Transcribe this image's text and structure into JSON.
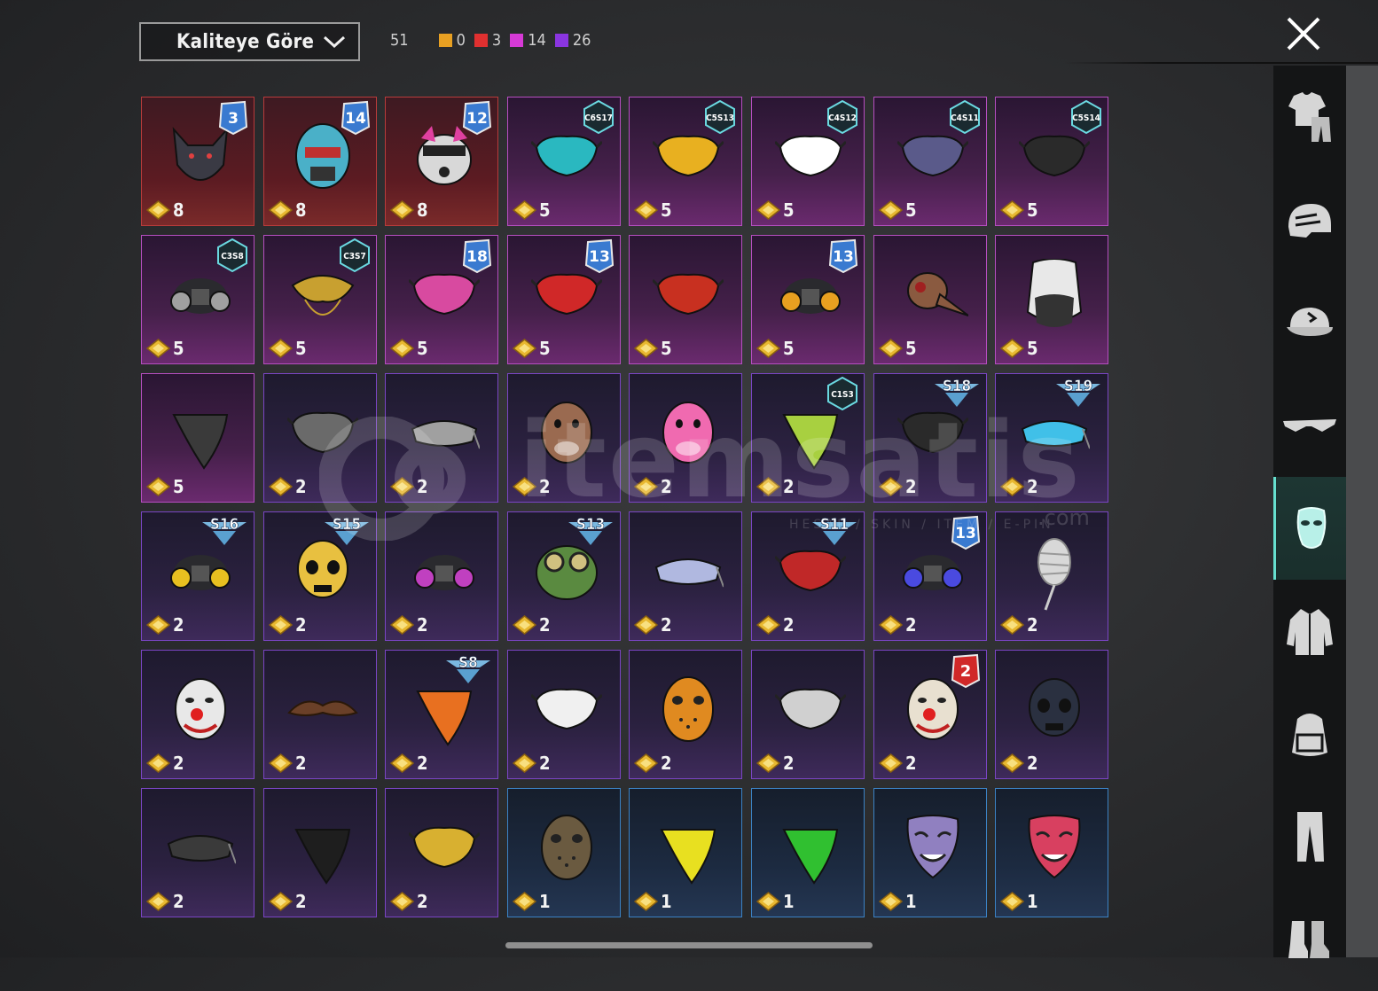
{
  "sort": {
    "label": "Kaliteye Göre"
  },
  "counts": {
    "total": "51",
    "quality": [
      {
        "color": "#e8a022",
        "value": "0"
      },
      {
        "color": "#e03030",
        "value": "3"
      },
      {
        "color": "#d63ad6",
        "value": "14"
      },
      {
        "color": "#8a35e0",
        "value": "26"
      }
    ]
  },
  "watermark": {
    "text": "itemsatis",
    "sub": "HESAP / SKIN / ITEM / E-PIN",
    "domain": ".com"
  },
  "sidebar": {
    "categories": [
      {
        "name": "outfit",
        "icon": "outfit-icon"
      },
      {
        "name": "helmet",
        "icon": "helmet-icon"
      },
      {
        "name": "hat",
        "icon": "cap-icon"
      },
      {
        "name": "glasses",
        "icon": "glasses-icon"
      },
      {
        "name": "mask",
        "icon": "mask-icon",
        "active": true
      },
      {
        "name": "jacket",
        "icon": "jacket-icon"
      },
      {
        "name": "backpack",
        "icon": "backpack-icon"
      },
      {
        "name": "pants",
        "icon": "pants-icon"
      },
      {
        "name": "shoes",
        "icon": "shoes-icon"
      }
    ]
  },
  "items": [
    {
      "rarity": "red",
      "badge": "3",
      "badge_type": "rank",
      "price": "8",
      "art": "wolf-mask",
      "color": "#3a3a44"
    },
    {
      "rarity": "red",
      "badge": "14",
      "badge_type": "rank",
      "price": "8",
      "art": "cyber-helmet-mask",
      "color": "#4ab0c8"
    },
    {
      "rarity": "red",
      "badge": "12",
      "badge_type": "rank",
      "price": "8",
      "art": "dog-mask",
      "color": "#d8d8d8"
    },
    {
      "rarity": "pink",
      "badge": "C6S17",
      "badge_type": "season",
      "price": "5",
      "art": "face-mask",
      "color": "#2ab8c0"
    },
    {
      "rarity": "pink",
      "badge": "C5S13",
      "badge_type": "season",
      "price": "5",
      "art": "face-mask",
      "color": "#e8b020"
    },
    {
      "rarity": "pink",
      "badge": "C4S12",
      "badge_type": "season",
      "price": "5",
      "art": "face-mask",
      "color": "#ffffff"
    },
    {
      "rarity": "pink",
      "badge": "C4S11",
      "badge_type": "season",
      "price": "5",
      "art": "face-mask",
      "color": "#5a5a8a"
    },
    {
      "rarity": "pink",
      "badge": "C5S14",
      "badge_type": "season",
      "price": "5",
      "art": "face-mask",
      "color": "#2a2a2a"
    },
    {
      "rarity": "pink",
      "badge": "C3S8",
      "badge_type": "season",
      "price": "5",
      "art": "respirator",
      "color": "#a0a0a0"
    },
    {
      "rarity": "pink",
      "badge": "C3S7",
      "badge_type": "season",
      "price": "5",
      "art": "gold-mask",
      "color": "#c8a030"
    },
    {
      "rarity": "pink",
      "badge": "18",
      "badge_type": "rank",
      "price": "5",
      "art": "face-mask",
      "color": "#d84aa0"
    },
    {
      "rarity": "pink",
      "badge": "13",
      "badge_type": "rank",
      "price": "5",
      "art": "face-mask",
      "color": "#d02828"
    },
    {
      "rarity": "pink",
      "badge": "",
      "badge_type": "",
      "price": "5",
      "art": "face-mask",
      "color": "#c83020"
    },
    {
      "rarity": "pink",
      "badge": "13",
      "badge_type": "rank",
      "price": "5",
      "art": "respirator",
      "color": "#e8a020"
    },
    {
      "rarity": "pink",
      "badge": "",
      "badge_type": "",
      "price": "5",
      "art": "plague-mask",
      "color": "#8a5a40"
    },
    {
      "rarity": "pink",
      "badge": "",
      "badge_type": "",
      "price": "5",
      "art": "hood-mask",
      "color": "#e8e8e8"
    },
    {
      "rarity": "pink",
      "badge": "",
      "badge_type": "",
      "price": "5",
      "art": "bandana",
      "color": "#3a3a3a"
    },
    {
      "rarity": "purple",
      "badge": "",
      "badge_type": "",
      "price": "2",
      "art": "face-mask",
      "color": "#6a6a6a"
    },
    {
      "rarity": "purple",
      "badge": "",
      "badge_type": "",
      "price": "2",
      "art": "visor",
      "color": "#a0a0a0"
    },
    {
      "rarity": "purple",
      "badge": "",
      "badge_type": "",
      "price": "2",
      "art": "animal-head",
      "color": "#9a6a50"
    },
    {
      "rarity": "purple",
      "badge": "",
      "badge_type": "",
      "price": "2",
      "art": "animal-head",
      "color": "#f06ab0"
    },
    {
      "rarity": "purple",
      "badge": "C1S3",
      "badge_type": "season",
      "price": "2",
      "art": "bandana",
      "color": "#a8d040"
    },
    {
      "rarity": "purple",
      "badge": "S18",
      "badge_type": "wing",
      "price": "2",
      "art": "face-mask",
      "color": "#2a2a2a"
    },
    {
      "rarity": "purple",
      "badge": "S19",
      "badge_type": "wing",
      "price": "2",
      "art": "visor",
      "color": "#40c0e8"
    },
    {
      "rarity": "purple",
      "badge": "S16",
      "badge_type": "wing",
      "price": "2",
      "art": "respirator",
      "color": "#e8c020"
    },
    {
      "rarity": "purple",
      "badge": "S15",
      "badge_type": "wing",
      "price": "2",
      "art": "skull-mask",
      "color": "#e8c040"
    },
    {
      "rarity": "purple",
      "badge": "",
      "badge_type": "",
      "price": "2",
      "art": "respirator",
      "color": "#c040c0"
    },
    {
      "rarity": "purple",
      "badge": "S13",
      "badge_type": "wing",
      "price": "2",
      "art": "goggles-mask",
      "color": "#5a8a40"
    },
    {
      "rarity": "purple",
      "badge": "",
      "badge_type": "",
      "price": "2",
      "art": "visor",
      "color": "#b0b8e0"
    },
    {
      "rarity": "purple",
      "badge": "S11",
      "badge_type": "wing",
      "price": "2",
      "art": "face-mask",
      "color": "#c02828"
    },
    {
      "rarity": "purple",
      "badge": "13",
      "badge_type": "rank",
      "price": "2",
      "art": "respirator",
      "color": "#4a4ae0"
    },
    {
      "rarity": "purple",
      "badge": "",
      "badge_type": "",
      "price": "2",
      "art": "bandage-mask",
      "color": "#d8d8d8"
    },
    {
      "rarity": "purple",
      "badge": "",
      "badge_type": "",
      "price": "2",
      "art": "clown-mask",
      "color": "#e8e8e8"
    },
    {
      "rarity": "purple",
      "badge": "",
      "badge_type": "",
      "price": "2",
      "art": "mustache",
      "color": "#6a4028"
    },
    {
      "rarity": "purple",
      "badge": "S8",
      "badge_type": "wing",
      "price": "2",
      "art": "bandana",
      "color": "#e87020"
    },
    {
      "rarity": "purple",
      "badge": "",
      "badge_type": "",
      "price": "2",
      "art": "face-mask",
      "color": "#f0f0f0"
    },
    {
      "rarity": "purple",
      "badge": "",
      "badge_type": "",
      "price": "2",
      "art": "hockey-mask",
      "color": "#e08a20"
    },
    {
      "rarity": "purple",
      "badge": "",
      "badge_type": "",
      "price": "2",
      "art": "face-mask",
      "color": "#d0d0d0"
    },
    {
      "rarity": "purple",
      "badge": "2",
      "badge_type": "rank-red",
      "price": "2",
      "art": "clown-mask",
      "color": "#e8e0d0"
    },
    {
      "rarity": "purple",
      "badge": "",
      "badge_type": "",
      "price": "2",
      "art": "skull-mask",
      "color": "#2a3040"
    },
    {
      "rarity": "purple",
      "badge": "",
      "badge_type": "",
      "price": "2",
      "art": "visor",
      "color": "#3a3a3a"
    },
    {
      "rarity": "purple",
      "badge": "",
      "badge_type": "",
      "price": "2",
      "art": "bandana",
      "color": "#1e1e1e"
    },
    {
      "rarity": "purple",
      "badge": "",
      "badge_type": "",
      "price": "2",
      "art": "face-mask",
      "color": "#d8b030"
    },
    {
      "rarity": "blue",
      "badge": "",
      "badge_type": "",
      "price": "1",
      "art": "hockey-mask",
      "color": "#6a5a40"
    },
    {
      "rarity": "blue",
      "badge": "",
      "badge_type": "",
      "price": "1",
      "art": "bandana",
      "color": "#e8e020"
    },
    {
      "rarity": "blue",
      "badge": "",
      "badge_type": "",
      "price": "1",
      "art": "bandana",
      "color": "#30c030"
    },
    {
      "rarity": "blue",
      "badge": "",
      "badge_type": "",
      "price": "1",
      "art": "theater-mask",
      "color": "#9080c0"
    },
    {
      "rarity": "blue",
      "badge": "",
      "badge_type": "",
      "price": "1",
      "art": "theater-mask",
      "color": "#d84060"
    }
  ]
}
